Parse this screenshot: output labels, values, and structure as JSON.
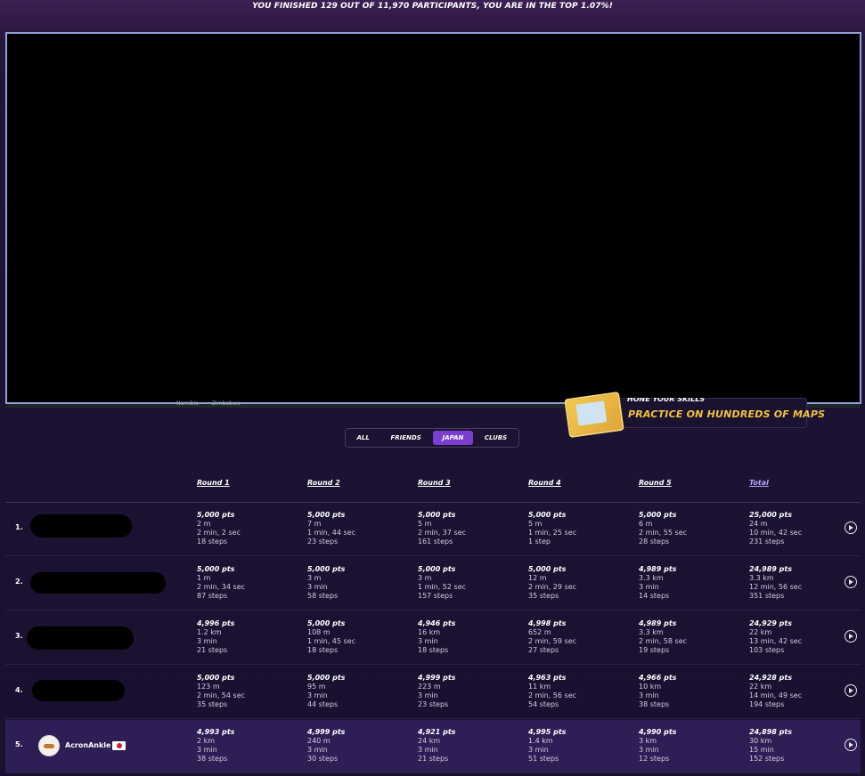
{
  "banner": "YOU FINISHED 129 OUT OF 11,970 PARTICIPANTS, YOU ARE IN THE TOP 1.07%!",
  "map": {
    "labels": [
      "Namibia",
      "Zimbabwe"
    ]
  },
  "promo": {
    "top_text": "HONE YOUR SKILLS",
    "text": "PRACTICE ON HUNDREDS OF MAPS"
  },
  "tabs": [
    {
      "label": "ALL",
      "active": false
    },
    {
      "label": "FRIENDS",
      "active": false
    },
    {
      "label": "JAPAN",
      "active": true
    },
    {
      "label": "CLUBS",
      "active": false
    }
  ],
  "columns": [
    "Round 1",
    "Round 2",
    "Round 3",
    "Round 4",
    "Round 5",
    "Total"
  ],
  "rows": [
    {
      "rank": "1.",
      "name": "",
      "redacted": true,
      "cells": [
        [
          "5,000 pts",
          "2 m",
          "2 min, 2 sec",
          "18 steps"
        ],
        [
          "5,000 pts",
          "7 m",
          "1 min, 44 sec",
          "23 steps"
        ],
        [
          "5,000 pts",
          "5 m",
          "2 min, 37 sec",
          "161 steps"
        ],
        [
          "5,000 pts",
          "5 m",
          "1 min, 25 sec",
          "1 step"
        ],
        [
          "5,000 pts",
          "6 m",
          "2 min, 55 sec",
          "28 steps"
        ],
        [
          "25,000 pts",
          "24 m",
          "10 min, 42 sec",
          "231 steps"
        ]
      ]
    },
    {
      "rank": "2.",
      "name": "",
      "redacted": true,
      "cells": [
        [
          "5,000 pts",
          "1 m",
          "2 min, 34 sec",
          "87 steps"
        ],
        [
          "5,000 pts",
          "3 m",
          "3 min",
          "58 steps"
        ],
        [
          "5,000 pts",
          "3 m",
          "1 min, 52 sec",
          "157 steps"
        ],
        [
          "5,000 pts",
          "12 m",
          "2 min, 29 sec",
          "35 steps"
        ],
        [
          "4,989 pts",
          "3.3 km",
          "3 min",
          "14 steps"
        ],
        [
          "24,989 pts",
          "3.3 km",
          "12 min, 56 sec",
          "351 steps"
        ]
      ]
    },
    {
      "rank": "3.",
      "name": "",
      "redacted": true,
      "cells": [
        [
          "4,996 pts",
          "1.2 km",
          "3 min",
          "21 steps"
        ],
        [
          "5,000 pts",
          "108 m",
          "1 min, 45 sec",
          "18 steps"
        ],
        [
          "4,946 pts",
          "16 km",
          "3 min",
          "18 steps"
        ],
        [
          "4,998 pts",
          "652 m",
          "2 min, 59 sec",
          "27 steps"
        ],
        [
          "4,989 pts",
          "3.3 km",
          "2 min, 58 sec",
          "19 steps"
        ],
        [
          "24,929 pts",
          "22 km",
          "13 min, 42 sec",
          "103 steps"
        ]
      ]
    },
    {
      "rank": "4.",
      "name": "",
      "redacted": true,
      "cells": [
        [
          "5,000 pts",
          "123 m",
          "2 min, 54 sec",
          "35 steps"
        ],
        [
          "5,000 pts",
          "95 m",
          "3 min",
          "44 steps"
        ],
        [
          "4,999 pts",
          "223 m",
          "3 min",
          "23 steps"
        ],
        [
          "4,963 pts",
          "11 km",
          "2 min, 56 sec",
          "54 steps"
        ],
        [
          "4,966 pts",
          "10 km",
          "3 min",
          "38 steps"
        ],
        [
          "24,928 pts",
          "22 km",
          "14 min, 49 sec",
          "194 steps"
        ]
      ]
    },
    {
      "rank": "5.",
      "name": "AcronAnkle",
      "redacted": false,
      "cells": [
        [
          "4,993 pts",
          "2 km",
          "3 min",
          "38 steps"
        ],
        [
          "4,999 pts",
          "240 m",
          "3 min",
          "30 steps"
        ],
        [
          "4,921 pts",
          "24 km",
          "3 min",
          "21 steps"
        ],
        [
          "4,995 pts",
          "1.4 km",
          "3 min",
          "51 steps"
        ],
        [
          "4,990 pts",
          "3 km",
          "3 min",
          "12 steps"
        ],
        [
          "24,898 pts",
          "30 km",
          "15 min",
          "152 steps"
        ]
      ]
    }
  ]
}
